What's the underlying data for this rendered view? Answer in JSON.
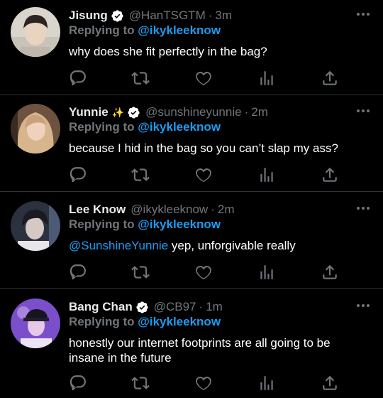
{
  "tweets": [
    {
      "name": "Jisung",
      "emoji": "",
      "handle": "@HanTSGTM",
      "dot": "·",
      "time": "3m",
      "replying_prefix": "Replying to",
      "replying_to": "@ikykleeknow",
      "mention": "",
      "text": "why does she fit perfectly in the bag?",
      "avatar_color": "#d8d2c8"
    },
    {
      "name": "Yunnie",
      "emoji": "✨",
      "handle": "@sunshineyunnie",
      "dot": "·",
      "time": "2m",
      "replying_prefix": "Replying to",
      "replying_to": "@ikykleeknow",
      "mention": "",
      "text": "because I hid in the bag so you can’t slap my ass?",
      "avatar_color": "#a8826a"
    },
    {
      "name": "Lee Know",
      "emoji": "",
      "handle": "@ikykleeknow",
      "dot": "·",
      "time": "2m",
      "replying_prefix": "Replying to",
      "replying_to": "@ikykleeknow",
      "mention": "@SunshineYunnie",
      "text": " yep, unforgivable really",
      "avatar_color": "#3f4656"
    },
    {
      "name": "Bang Chan",
      "emoji": "",
      "handle": "@CB97",
      "dot": "·",
      "time": "1m",
      "replying_prefix": "Replying to",
      "replying_to": "@ikykleeknow",
      "mention": "",
      "text": "honestly our internet footprints are all going to be insane in the future",
      "avatar_color": "#8a5ad0"
    }
  ],
  "icons": [
    "reply-icon",
    "retweet-icon",
    "like-icon",
    "views-icon",
    "share-icon",
    "more-icon",
    "verified-badge-icon"
  ],
  "colors": {
    "background": "#000000",
    "link": "#1d9bf0",
    "muted": "#71767b",
    "divider": "#2f3336",
    "verified": "#ffffff"
  }
}
